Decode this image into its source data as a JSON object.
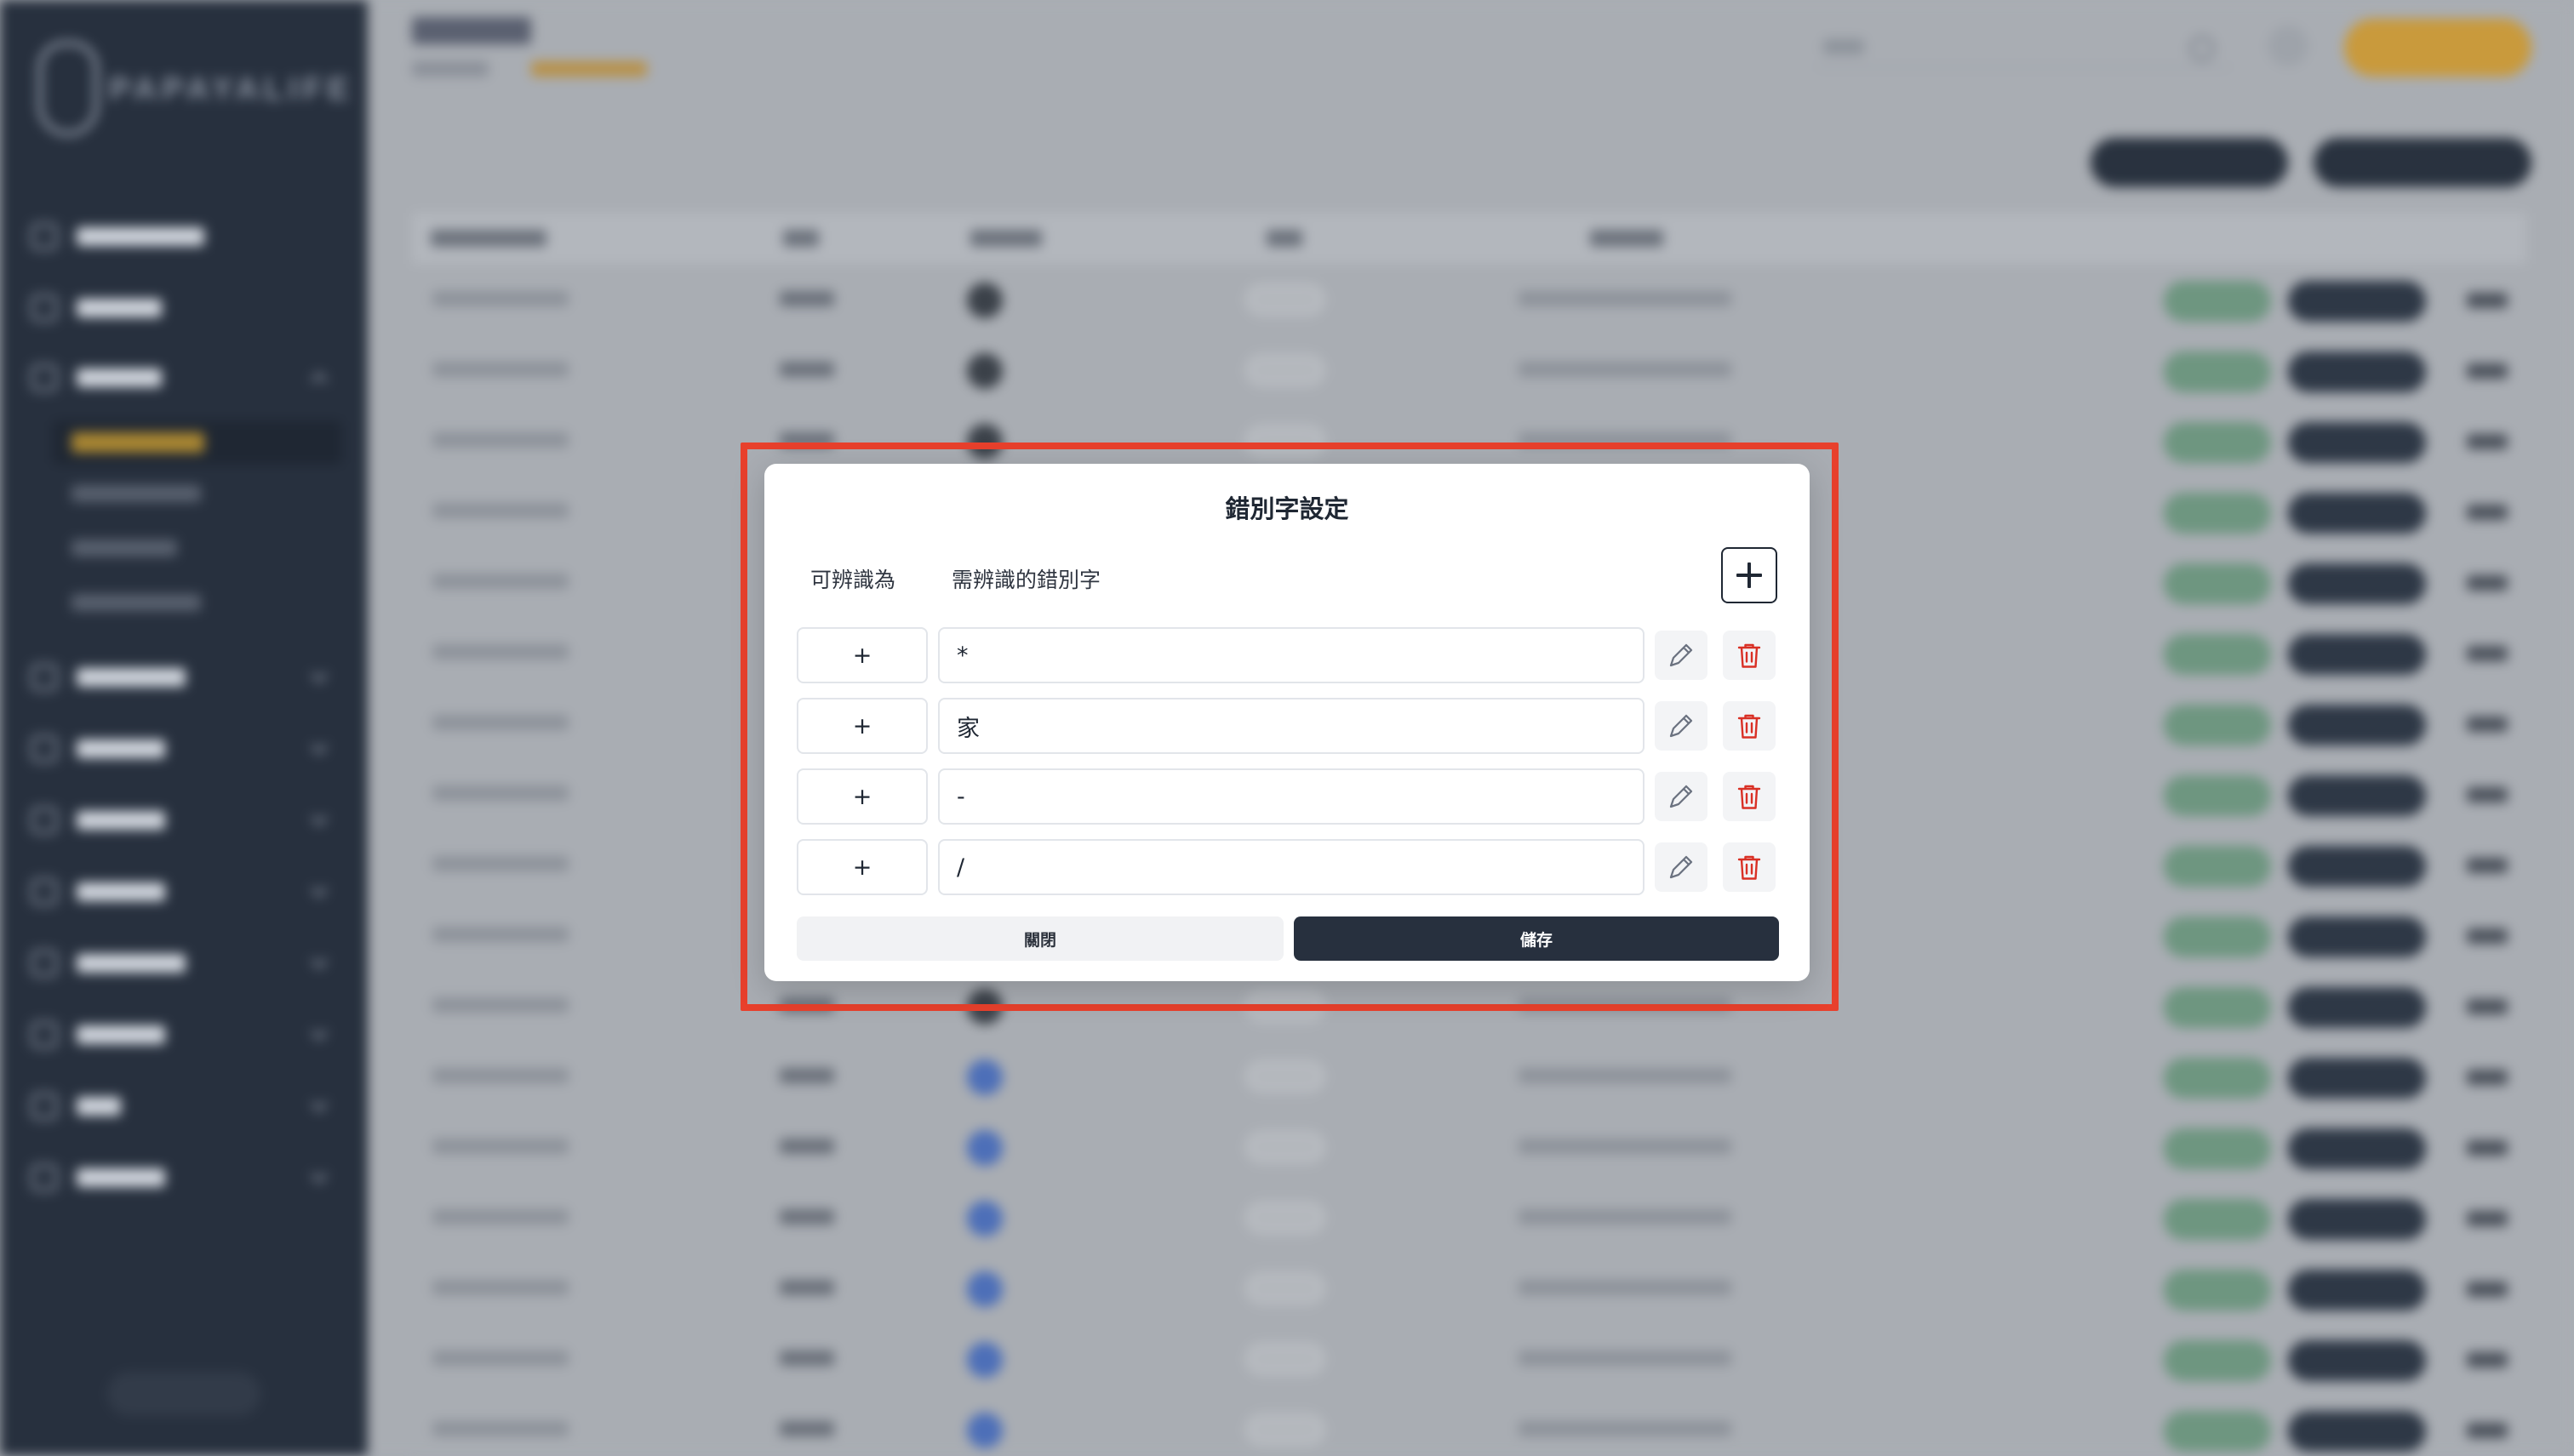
{
  "modal": {
    "title": "錯別字設定",
    "col_recognized": "可辨識為",
    "col_typos": "需辨識的錯別字",
    "add_icon": "plus-icon",
    "rows": [
      {
        "recognized": "+",
        "typo": "*"
      },
      {
        "recognized": "+",
        "typo": "家"
      },
      {
        "recognized": "+",
        "typo": "-"
      },
      {
        "recognized": "+",
        "typo": "/"
      }
    ],
    "close_label": "關閉",
    "save_label": "儲存"
  },
  "icons": {
    "edit": "pencil-icon",
    "delete": "trash-icon"
  },
  "colors": {
    "sidebar": "#27303e",
    "accent": "#c99a3c",
    "danger": "#d93025",
    "highlight": "#e8402c",
    "primary_button": "#27303e"
  }
}
